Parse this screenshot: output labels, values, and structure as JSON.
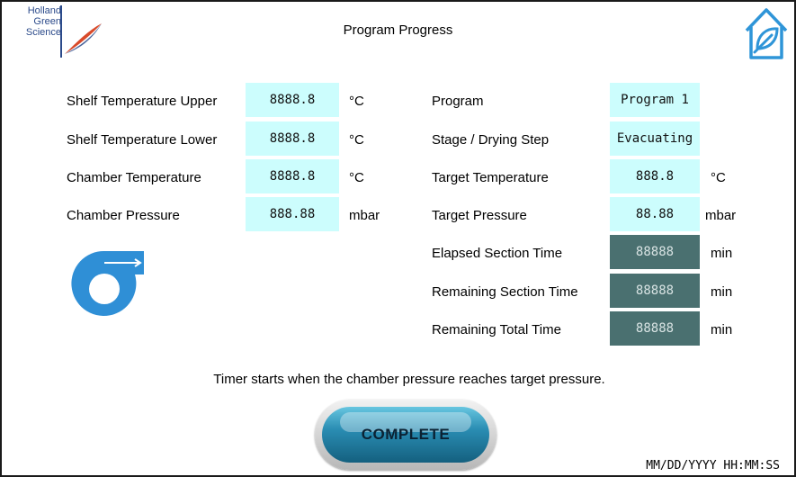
{
  "logo": {
    "line1": "Holland",
    "line2": "Green",
    "line3": "Science"
  },
  "header": {
    "title": "Program Progress",
    "home_icon": "home-leaf-icon"
  },
  "left_panel": {
    "shelf_upper": {
      "label": "Shelf Temperature Upper",
      "value": "8888.8",
      "unit": "°C"
    },
    "shelf_lower": {
      "label": "Shelf Temperature Lower",
      "value": "8888.8",
      "unit": "°C"
    },
    "chamber_temp": {
      "label": "Chamber Temperature",
      "value": "8888.8",
      "unit": "°C"
    },
    "chamber_pressure": {
      "label": "Chamber Pressure",
      "value": "888.88",
      "unit": "mbar"
    },
    "pump_icon": "vacuum-pump-icon"
  },
  "right_panel": {
    "program": {
      "label": "Program",
      "value": "Program 1"
    },
    "stage": {
      "label": "Stage / Drying Step",
      "value": "Evacuating"
    },
    "target_temp": {
      "label": "Target Temperature",
      "value": "888.8",
      "unit": "°C"
    },
    "target_pressure": {
      "label": "Target Pressure",
      "value": "88.88",
      "unit": "mbar"
    },
    "elapsed": {
      "label": "Elapsed Section Time",
      "value": "88888",
      "unit": "min"
    },
    "remaining_section": {
      "label": "Remaining Section Time",
      "value": "88888",
      "unit": "min"
    },
    "remaining_total": {
      "label": "Remaining Total Time",
      "value": "88888",
      "unit": "min"
    }
  },
  "note": "Timer starts when the chamber pressure reaches target pressure.",
  "complete_button": "COMPLETE",
  "timestamp": "MM/DD/YYYY HH:MM:SS",
  "colors": {
    "value_box": "#ccfdfd",
    "dark_box": "#4a7070",
    "pump_blue": "#2f8fd6",
    "home_blue": "#2f95d8",
    "logo_blue": "#2b4a8a",
    "logo_red": "#d94a2a"
  }
}
